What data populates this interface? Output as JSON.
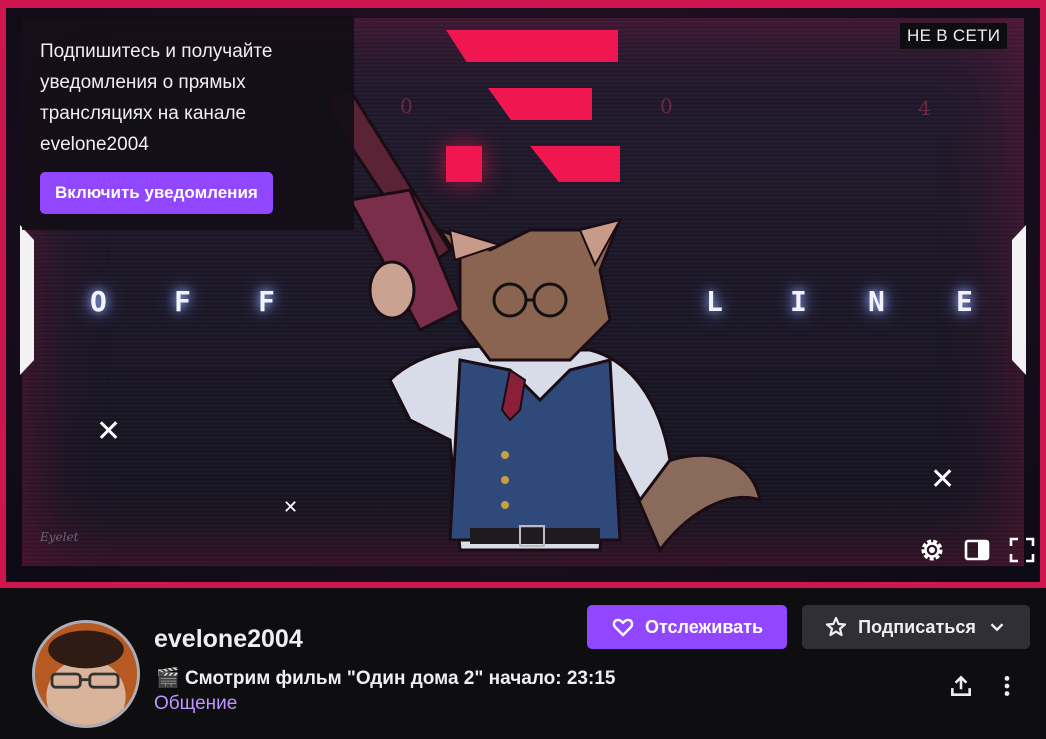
{
  "player": {
    "offline_badge": "НЕ В СЕТИ",
    "banner_word_left": [
      "O",
      "F",
      "F"
    ],
    "banner_word_right": [
      "L",
      "I",
      "N",
      "E"
    ],
    "banner_numbers": [
      "0",
      "0",
      "4"
    ],
    "signature": "Eyelet",
    "notify": {
      "text": "Подпишитесь и получайте уведомления о прямых трансляциях на канале evelone2004",
      "button_label": "Включить уведомления"
    },
    "controls": [
      "settings-icon",
      "theatre-mode-icon",
      "fullscreen-icon"
    ]
  },
  "channel": {
    "name": "evelone2004",
    "title_emoji": "🎬",
    "title": "Смотрим фильм \"Один дома 2\" начало: 23:15",
    "category": "Общение"
  },
  "actions": {
    "follow_label": "Отслеживать",
    "subscribe_label": "Подписаться",
    "share_icon": "share-icon",
    "more_icon": "more-vertical-icon"
  },
  "colors": {
    "accent": "#9147ff",
    "category": "#bf94ff",
    "banner_red": "#f0164f",
    "background": "#0e0e10"
  }
}
